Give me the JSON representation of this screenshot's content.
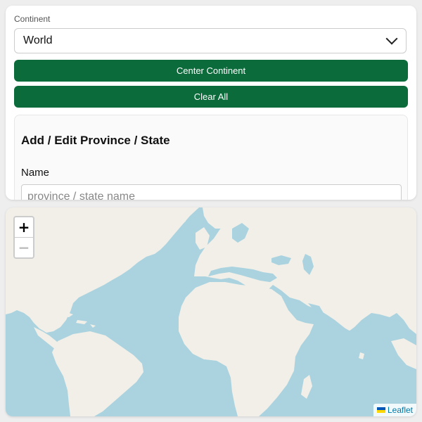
{
  "controls": {
    "continent_label": "Continent",
    "continent_selected": "World",
    "center_button_label": "Center Continent",
    "clear_button_label": "Clear All"
  },
  "editor": {
    "title": "Add / Edit Province / State",
    "name_label": "Name",
    "name_placeholder": "province / state name",
    "name_value": ""
  },
  "map": {
    "zoom_in_label": "+",
    "zoom_out_label": "−",
    "attribution_label": "Leaflet",
    "attribution_icon": "ukraine-flag-icon",
    "water_color": "#aad3df",
    "land_color": "#f2efe9"
  },
  "colors": {
    "primary": "#0b6b3a",
    "panel": "#ffffff",
    "background": "#eeeeee"
  }
}
